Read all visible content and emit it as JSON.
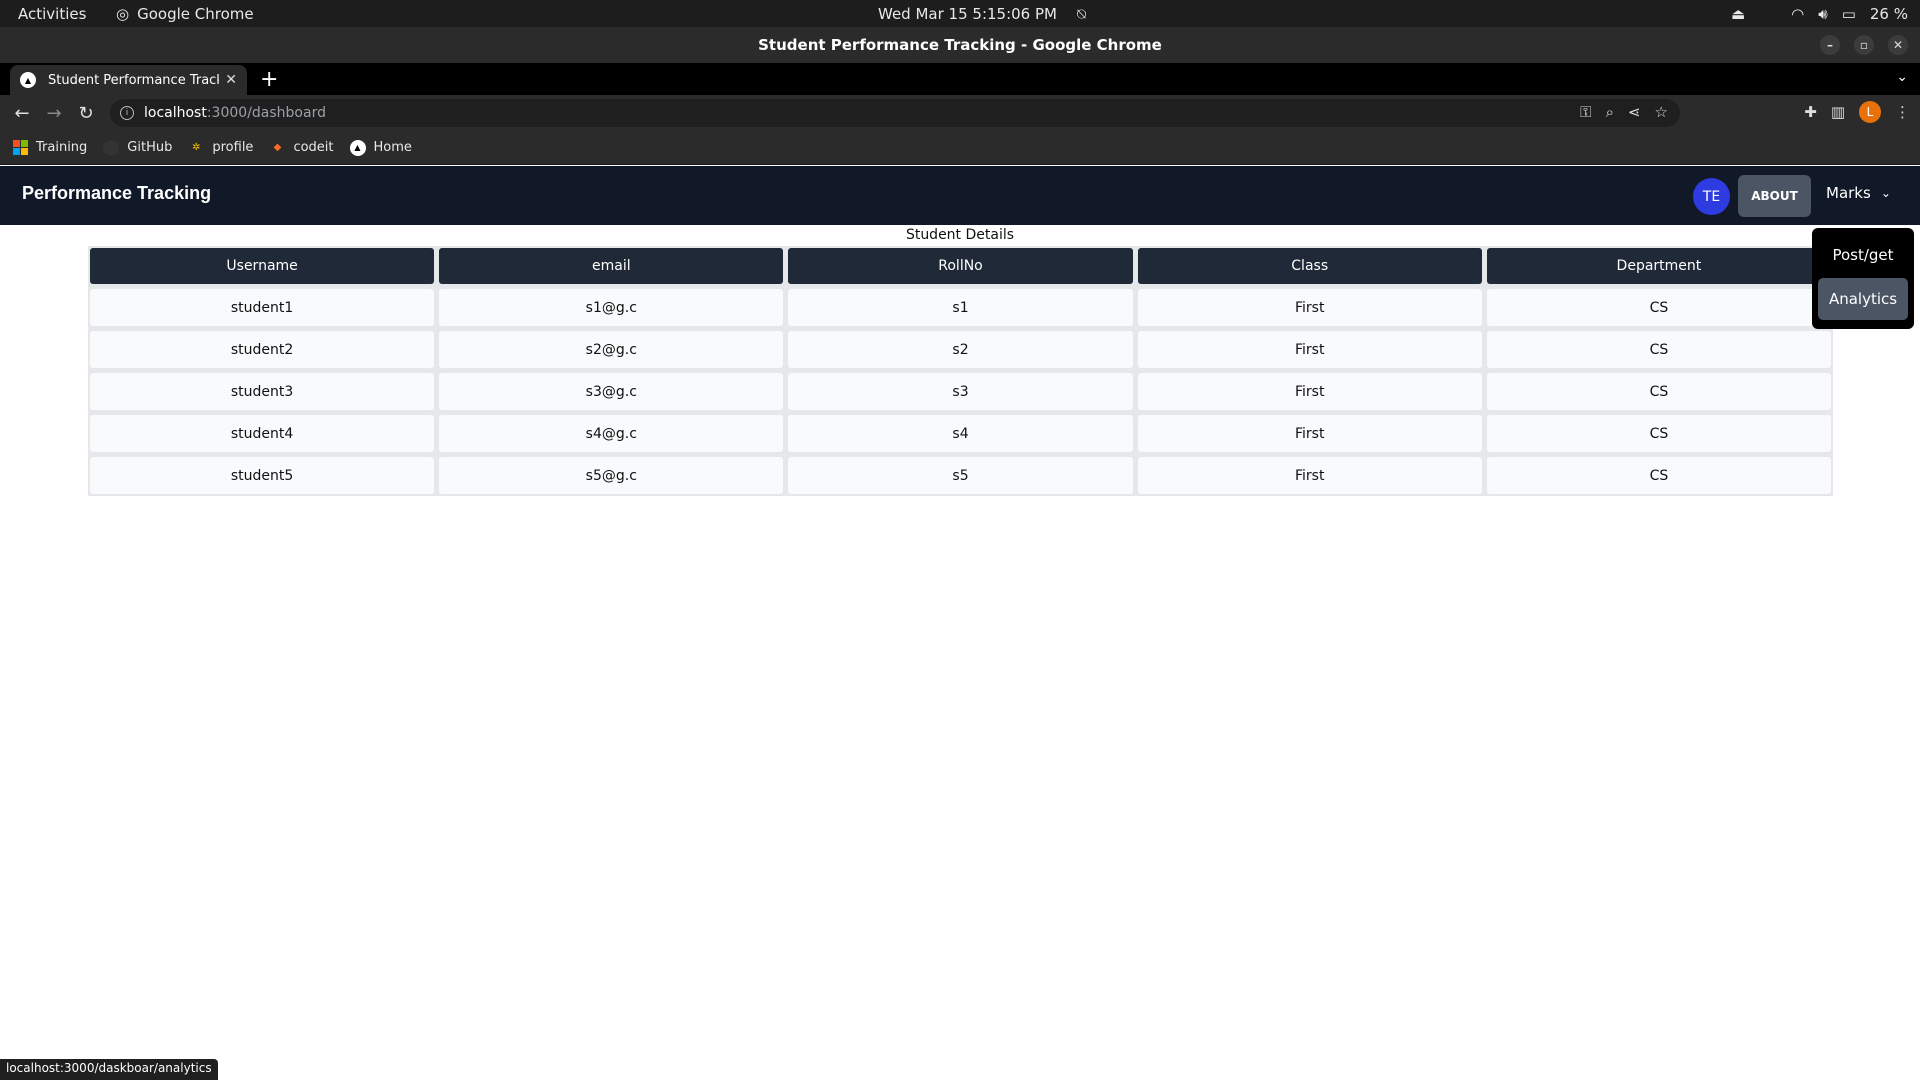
{
  "os": {
    "activities": "Activities",
    "app_name": "Google Chrome",
    "datetime": "Wed Mar 15  5:15:06 PM",
    "battery": "26 %"
  },
  "window": {
    "title": "Student Performance Tracking - Google Chrome"
  },
  "tab": {
    "title": "Student Performance Tracking",
    "favicon": "triangle-icon"
  },
  "address_bar": {
    "host": "localhost",
    "path": ":3000/dashboard"
  },
  "profile": {
    "initial": "L",
    "color": "#e8710a"
  },
  "bookmarks": [
    {
      "label": "Training",
      "icon": "windows-icon"
    },
    {
      "label": "GitHub",
      "icon": "github-icon"
    },
    {
      "label": "profile",
      "icon": "pinwheel-icon"
    },
    {
      "label": "codeit",
      "icon": "gitlab-icon"
    },
    {
      "label": "Home",
      "icon": "triangle-icon"
    }
  ],
  "app": {
    "brand": "Performance Tracking",
    "user_initials": "TE",
    "about_label": "ABOUT",
    "marks_label": "Marks",
    "nav_bg": "#111827"
  },
  "dropdown": {
    "items": [
      "Post/get",
      "Analytics"
    ],
    "active": "Analytics"
  },
  "table": {
    "caption": "Student Details",
    "headers": [
      "Username",
      "email",
      "RollNo",
      "Class",
      "Department"
    ],
    "rows": [
      [
        "student1",
        "s1@g.c",
        "s1",
        "First",
        "CS"
      ],
      [
        "student2",
        "s2@g.c",
        "s2",
        "First",
        "CS"
      ],
      [
        "student3",
        "s3@g.c",
        "s3",
        "First",
        "CS"
      ],
      [
        "student4",
        "s4@g.c",
        "s4",
        "First",
        "CS"
      ],
      [
        "student5",
        "s5@g.c",
        "s5",
        "First",
        "CS"
      ]
    ]
  },
  "status_url": "localhost:3000/daskboar/analytics"
}
